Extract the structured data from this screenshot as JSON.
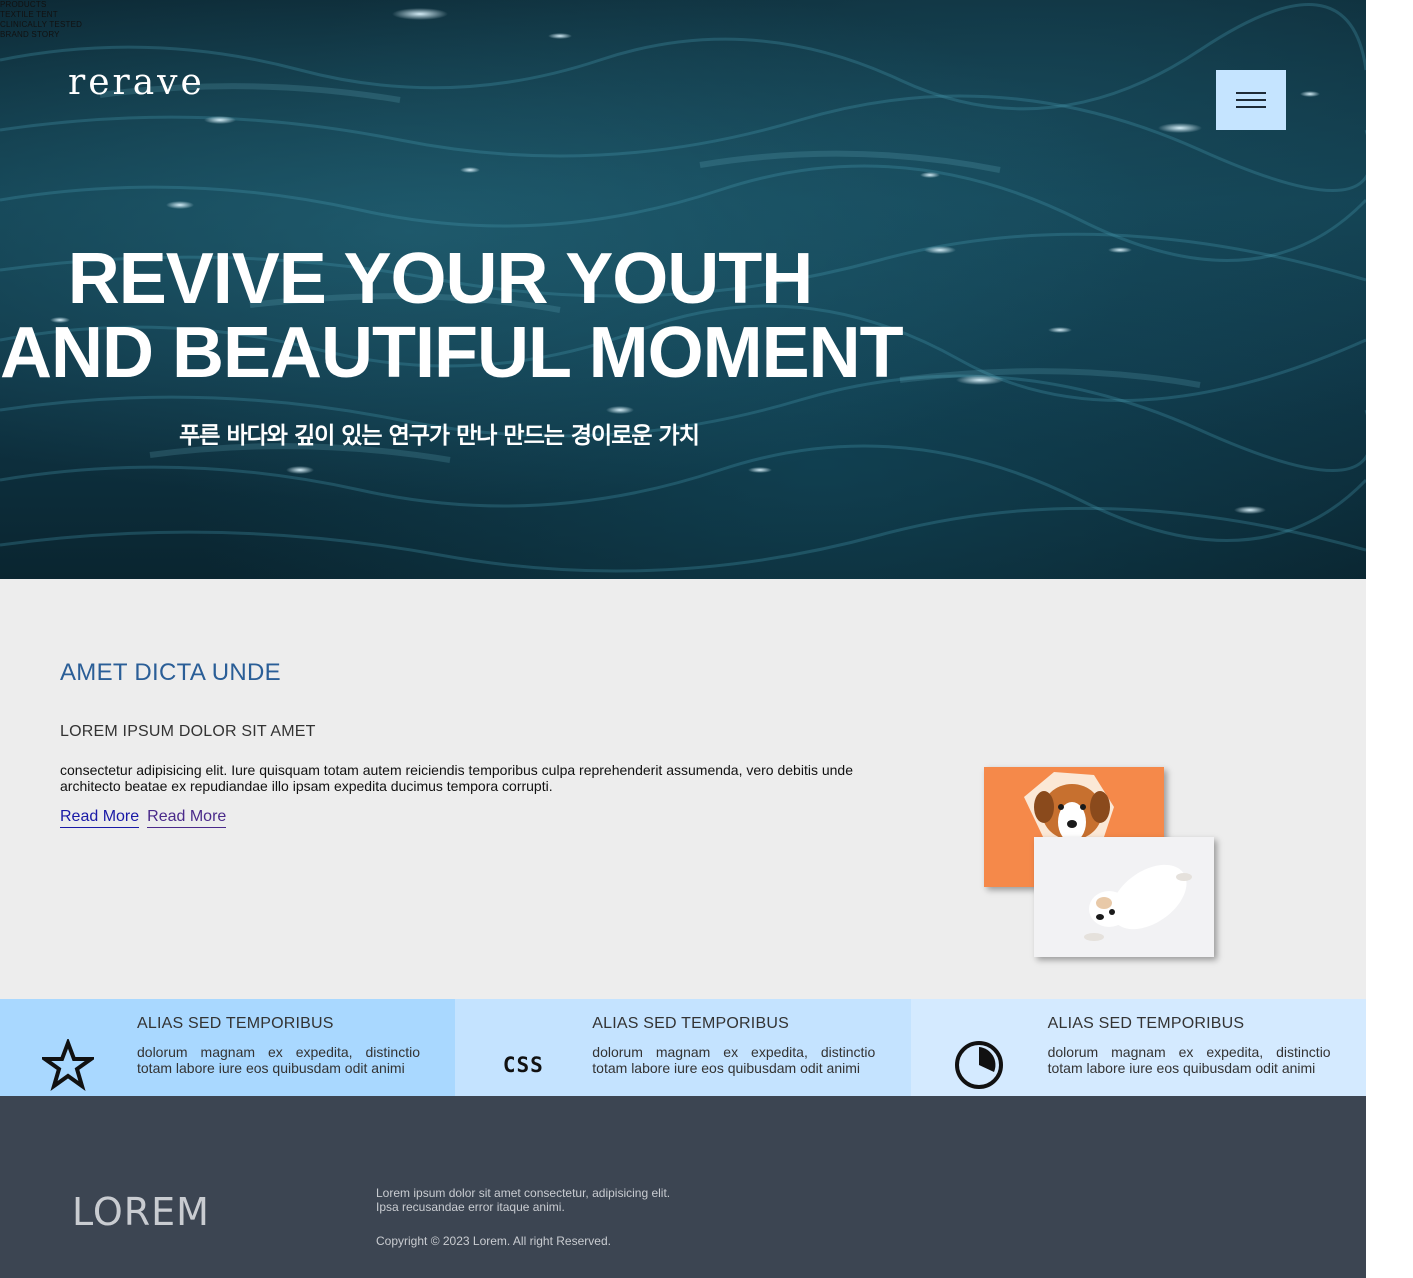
{
  "top_nav": [
    "PRODUCTS",
    "TEXTILE TENT",
    "CLINICALLY TESTED",
    "BRAND STORY"
  ],
  "header": {
    "logo": "rerave",
    "menu_icon": "hamburger-icon"
  },
  "hero": {
    "title_line1": "REVIVE YOUR YOUTH",
    "title_line2": "AND BEAUTIFUL MOMENT",
    "subtitle": "푸른 바다와 깊이 있는 연구가 만나 만드는 경이로운 가치"
  },
  "about": {
    "heading": "AMET DICTA UNDE",
    "subheading": "LOREM IPSUM DOLOR SIT AMET",
    "body": "consectetur adipisicing elit. Iure quisquam totam autem reiciendis temporibus culpa reprehenderit assumenda, vero debitis unde architecto beatae ex repudiandae illo ipsam expedita ducimus tempora corrupti.",
    "links": [
      "Read More",
      "Read More"
    ]
  },
  "features": [
    {
      "icon": "star-icon",
      "title": "ALIAS SED TEMPORIBUS",
      "text": "dolorum magnam ex expedita, distinctio totam labore iure eos quibusdam odit animi",
      "bg": "#a9d8ff"
    },
    {
      "icon": "css-icon",
      "icon_text": "CSS",
      "title": "ALIAS SED TEMPORIBUS",
      "text": "dolorum magnam ex expedita, distinctio totam labore iure eos quibusdam odit animi",
      "bg": "#c4e3ff"
    },
    {
      "icon": "pie-timer-icon",
      "title": "ALIAS SED TEMPORIBUS",
      "text": "dolorum magnam ex expedita, distinctio totam labore iure eos quibusdam odit animi",
      "bg": "#d4eaff"
    }
  ],
  "footer": {
    "logo": "LOREM",
    "text": "Lorem ipsum dolor sit amet consectetur, adipisicing elit. Ipsa recusandae error itaque animi.",
    "copyright": "Copyright © 2023 Lorem. All right Reserved."
  },
  "colors": {
    "accent": "#2a5e97",
    "menu_button": "#c5e4ff",
    "about_bg": "#ededed",
    "footer_bg": "#3c4552"
  }
}
